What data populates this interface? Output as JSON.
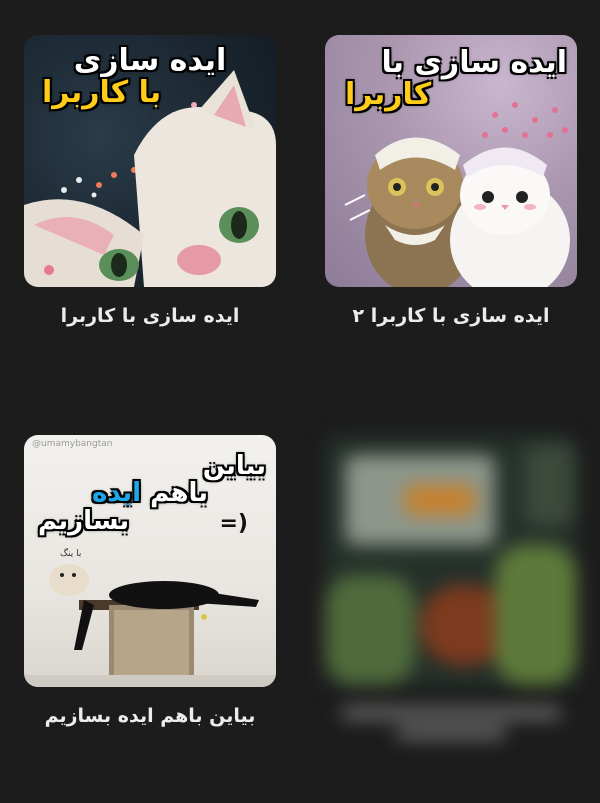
{
  "cards": [
    {
      "thumb_title_line1": "ایده سازی با",
      "thumb_title_line2": "کاربرا",
      "caption": "ایده سازی با کاربرا ۲"
    },
    {
      "thumb_title_line1": "ایده سازی",
      "thumb_title_line2_prefix": "با",
      "thumb_title_line2_accent": "کاربرا",
      "caption": "ایده سازی با کاربرا"
    },
    {
      "caption": "",
      "blurred": true
    },
    {
      "watermark": "@umamybangtan",
      "thumb_title_line1": "بیاین",
      "thumb_title_line2_prefix": "باهم",
      "thumb_title_line2_accent": "ایده",
      "thumb_title_line3": "بسازیم",
      "thumb_emoticon": "=)",
      "sticker_label": "با ینگ",
      "caption": "بیاین باهم ایده بسازیم"
    }
  ]
}
